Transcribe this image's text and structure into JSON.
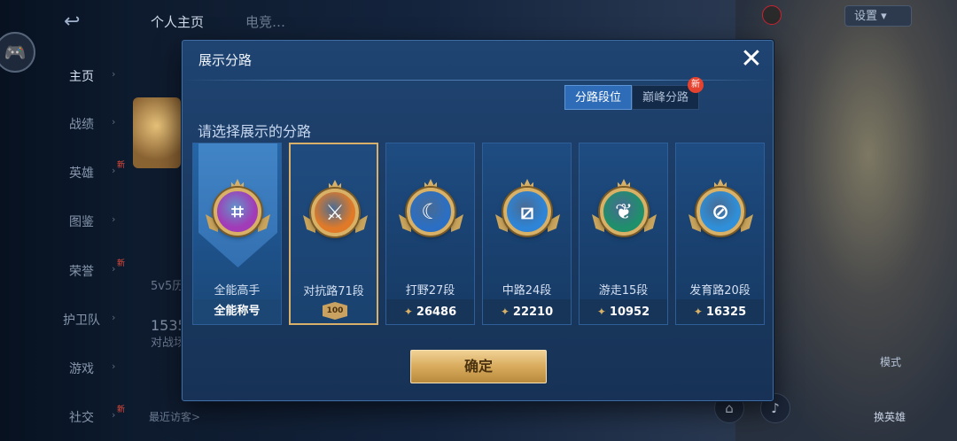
{
  "colors": {
    "modal_bg": "#1c3d66",
    "accent_gold": "#d8b066",
    "segment_active": "#2e6cb8",
    "new_badge": "#e5422f"
  },
  "background": {
    "back_icon": "back-arrow-icon",
    "top_tabs": [
      "个人主页",
      "电竞…"
    ],
    "settings_label": "设置",
    "sidebar": [
      {
        "label": "主页",
        "active": true,
        "new": false
      },
      {
        "label": "战绩",
        "active": false,
        "new": false
      },
      {
        "label": "英雄",
        "active": false,
        "new": true
      },
      {
        "label": "图鉴",
        "active": false,
        "new": false
      },
      {
        "label": "荣誉",
        "active": false,
        "new": true
      },
      {
        "label": "护卫队",
        "active": false,
        "new": false
      },
      {
        "label": "游戏",
        "active": false,
        "new": false
      },
      {
        "label": "社交",
        "active": false,
        "new": true
      }
    ],
    "mid_texts": [
      "5v5历…",
      "1535",
      "对战场…"
    ],
    "recent_visitors": "最近访客>",
    "switch_hero": "换英雄",
    "game_label": "模式"
  },
  "modal": {
    "title": "展示分路",
    "close_icon": "close-icon",
    "segments": [
      {
        "label": "分路段位",
        "active": true,
        "new_badge": ""
      },
      {
        "label": "巅峰分路",
        "active": false,
        "new_badge": "新"
      }
    ],
    "prompt": "请选择展示的分路",
    "lanes": [
      {
        "label": "全能高手",
        "footer": "全能称号",
        "points": "",
        "icon": "all-round-emblem-icon",
        "glyph": "⌗",
        "color": "#a23bb7",
        "selected": false,
        "rank_badge": ""
      },
      {
        "label": "对抗路71段",
        "footer": "",
        "points": "",
        "icon": "clash-lane-emblem-icon",
        "glyph": "⚔",
        "color": "#e07a28",
        "selected": true,
        "rank_badge": "100"
      },
      {
        "label": "打野27段",
        "footer": "",
        "points": "26486",
        "icon": "jungle-emblem-icon",
        "glyph": "☾",
        "color": "#2b6fc4",
        "selected": false,
        "rank_badge": ""
      },
      {
        "label": "中路24段",
        "footer": "",
        "points": "22210",
        "icon": "mid-lane-emblem-icon",
        "glyph": "⧄",
        "color": "#2e84d6",
        "selected": false,
        "rank_badge": ""
      },
      {
        "label": "游走15段",
        "footer": "",
        "points": "10952",
        "icon": "roam-emblem-icon",
        "glyph": "❦",
        "color": "#1f8f6c",
        "selected": false,
        "rank_badge": ""
      },
      {
        "label": "发育路20段",
        "footer": "",
        "points": "16325",
        "icon": "farm-lane-emblem-icon",
        "glyph": "⊘",
        "color": "#2f8fd8",
        "selected": false,
        "rank_badge": ""
      }
    ],
    "confirm_label": "确定"
  }
}
